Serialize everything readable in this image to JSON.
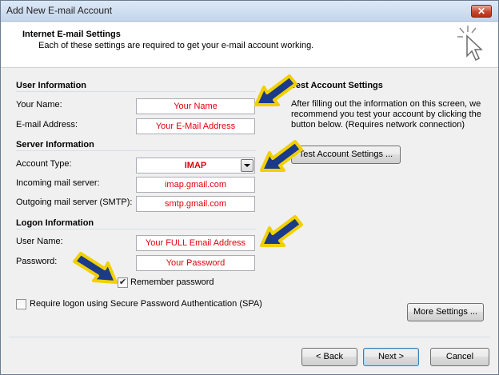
{
  "window": {
    "title": "Add New E-mail Account",
    "close_label": "✕"
  },
  "header": {
    "title": "Internet E-mail Settings",
    "subtitle": "Each of these settings are required to get your e-mail account working."
  },
  "user_info": {
    "title": "User Information",
    "name_label": "Your Name:",
    "name_value": "Your Name",
    "email_label": "E-mail Address:",
    "email_value": "Your E-Mail Address"
  },
  "server_info": {
    "title": "Server Information",
    "account_type_label": "Account Type:",
    "account_type_value": "IMAP",
    "incoming_label": "Incoming mail server:",
    "incoming_value": "imap.gmail.com",
    "outgoing_label": "Outgoing mail server (SMTP):",
    "outgoing_value": "smtp.gmail.com"
  },
  "logon_info": {
    "title": "Logon Information",
    "username_label": "User Name:",
    "username_value": "Your FULL Email Address",
    "password_label": "Password:",
    "password_value": "Your Password",
    "remember_label": "Remember password",
    "remember_checked": true,
    "spa_label": "Require logon using Secure Password Authentication (SPA)",
    "spa_checked": false
  },
  "test_settings": {
    "title": "Test Account Settings",
    "description": "After filling out the information on this screen, we recommend you test your account by clicking the button below. (Requires network connection)",
    "button_label": "Test Account Settings ..."
  },
  "more_settings_label": "More Settings ...",
  "footer": {
    "back_label": "< Back",
    "next_label": "Next >",
    "cancel_label": "Cancel"
  },
  "colors": {
    "field_text": "#e0000b",
    "arrow_fill": "#1b3a8a",
    "arrow_outline": "#f2d000"
  },
  "icons": {
    "header": "cursor-sparkle-icon",
    "annotation": "yellow-blue-arrow-icon"
  }
}
